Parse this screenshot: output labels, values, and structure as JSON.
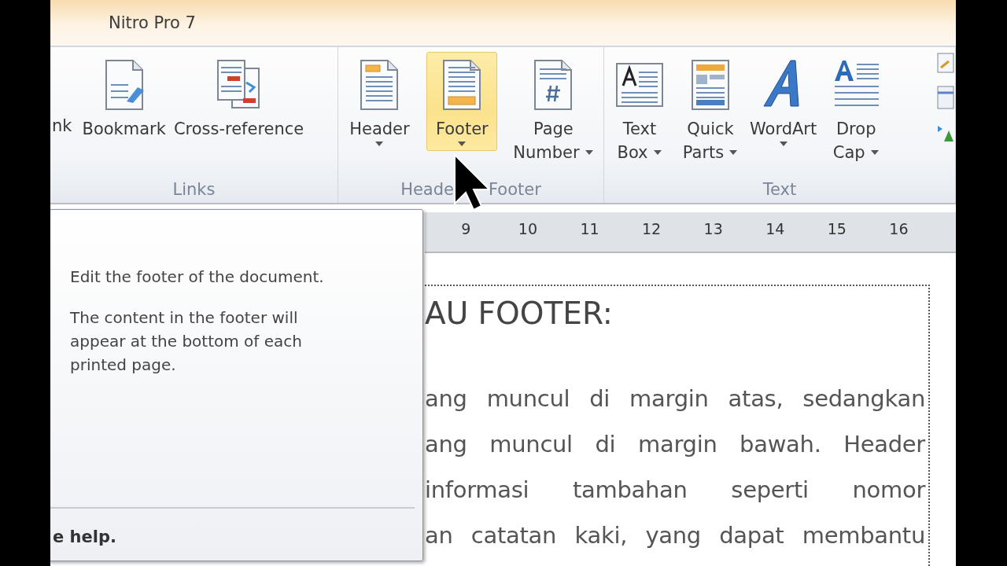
{
  "tabs": [
    {
      "label": "Nitro Pro 7",
      "selected": false
    }
  ],
  "ribbon": {
    "groups": [
      {
        "label_parts": [
          "Links"
        ],
        "clipped_label": "nk",
        "buttons": [
          {
            "kind": "bookmark",
            "lines": [
              "Bookmark"
            ],
            "selected": false
          },
          {
            "kind": "cross-reference",
            "lines": [
              "Cross-reference"
            ],
            "selected": false
          }
        ]
      },
      {
        "label_parts": [
          "Heade",
          "Footer"
        ],
        "buttons": [
          {
            "kind": "header",
            "lines": [
              "Header"
            ],
            "dropdown": true,
            "selected": false
          },
          {
            "kind": "footer",
            "lines": [
              "Footer"
            ],
            "dropdown": true,
            "selected": true
          },
          {
            "kind": "page-number",
            "lines": [
              "Page",
              "Number"
            ],
            "dropdown": true,
            "selected": false
          }
        ]
      },
      {
        "label_parts": [
          "Text"
        ],
        "extra_icons": true,
        "buttons": [
          {
            "kind": "text-box",
            "lines": [
              "Text",
              "Box"
            ],
            "dropdown": true,
            "selected": false
          },
          {
            "kind": "quick-parts",
            "lines": [
              "Quick",
              "Parts"
            ],
            "dropdown": true,
            "selected": false
          },
          {
            "kind": "wordart",
            "lines": [
              "WordArt"
            ],
            "dropdown": true,
            "selected": false
          },
          {
            "kind": "drop-cap",
            "lines": [
              "Drop",
              "Cap"
            ],
            "dropdown": true,
            "selected": false
          }
        ]
      }
    ]
  },
  "ruler": {
    "numbers": [
      "9",
      "10",
      "11",
      "12",
      "13",
      "14",
      "15",
      "16"
    ]
  },
  "document": {
    "heading": "AU FOOTER:",
    "lines": [
      "ang muncul di margin atas, sedangkan",
      "ang muncul di margin bawah. Header",
      "informasi tambahan seperti nomor",
      "an catatan kaki, yang dapat membantu"
    ]
  },
  "tooltip": {
    "paragraphs": [
      "Edit the footer of the document.",
      "The content in the footer will appear at the bottom of each printed page."
    ],
    "help": "e help."
  }
}
